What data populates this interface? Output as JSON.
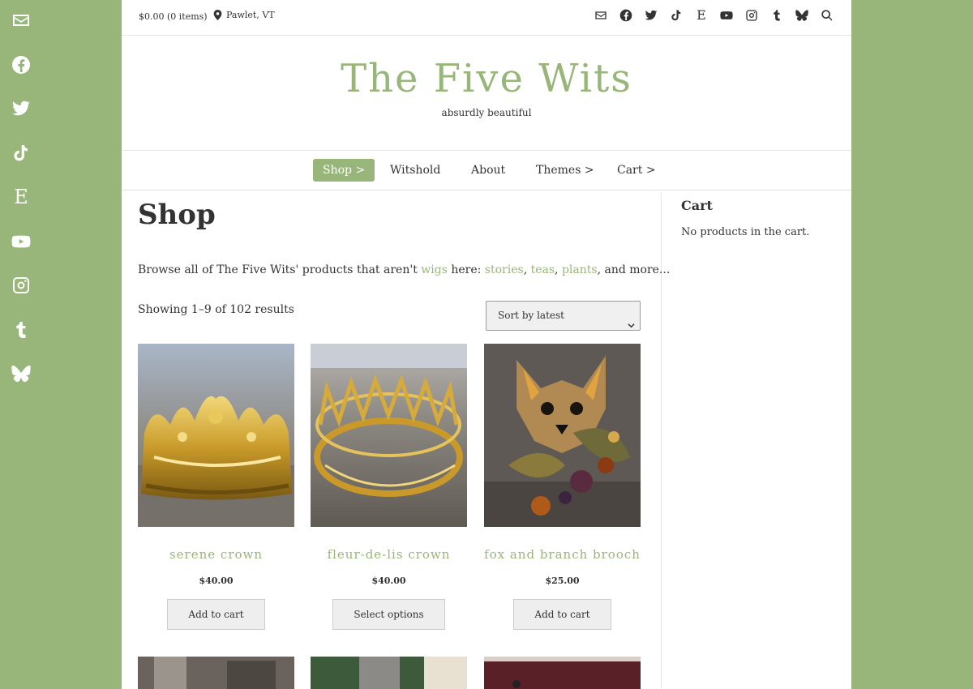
{
  "topbar": {
    "cart_summary": "$0.00 (0 items)",
    "location": "Pawlet, VT",
    "icons": [
      "envelope-icon",
      "facebook-icon",
      "twitter-icon",
      "tiktok-icon",
      "etsy-icon",
      "youtube-icon",
      "instagram-icon",
      "tumblr-icon",
      "bluesky-icon",
      "search-icon"
    ],
    "etsy_letter": "E"
  },
  "rail": {
    "icons": [
      "envelope-icon",
      "facebook-icon",
      "twitter-icon",
      "tiktok-icon",
      "etsy-icon",
      "youtube-icon",
      "instagram-icon",
      "tumblr-icon",
      "bluesky-icon"
    ],
    "etsy_letter": "E"
  },
  "brand": {
    "title": "The Five Wits",
    "tagline": "absurdly beautiful"
  },
  "nav": {
    "items": [
      {
        "label": "Shop >",
        "active": true
      },
      {
        "label": "Witshold"
      },
      {
        "label": "About"
      },
      {
        "label": "Themes >"
      },
      {
        "label": "Cart >"
      }
    ]
  },
  "main": {
    "title": "Shop",
    "intro_prefix": "Browse all of The Five Wits' products that aren't ",
    "intro_link_wigs": "wigs",
    "intro_mid": " here: ",
    "intro_link_stories": "stories",
    "intro_link_teas": "teas",
    "intro_link_plants": "plants",
    "intro_suffix": ", and more...",
    "comma": ", ",
    "result_count": "Showing 1–9 of 102 results",
    "sort_selected": "Sort by latest"
  },
  "products": [
    {
      "name": "serene crown",
      "price": "$40.00",
      "button": "Add to cart"
    },
    {
      "name": "fleur-de-lis crown",
      "price": "$40.00",
      "button": "Select options"
    },
    {
      "name": "fox and branch brooch",
      "price": "$25.00",
      "button": "Add to cart"
    }
  ],
  "sidebar": {
    "title": "Cart",
    "empty_text": "No products in the cart."
  },
  "colors": {
    "accent": "#98b679",
    "text": "#333333",
    "background": "#ffffff"
  }
}
